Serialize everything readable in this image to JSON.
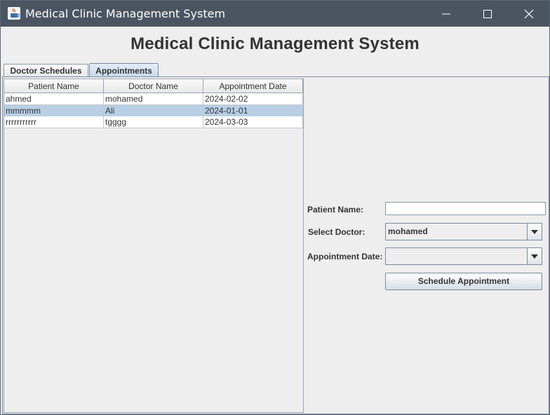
{
  "window": {
    "title": "Medical Clinic Management System",
    "controls": [
      "minimize-icon",
      "maximize-icon",
      "close-icon"
    ]
  },
  "header": {
    "title": "Medical Clinic Management System"
  },
  "tabs": [
    {
      "label": "Doctor Schedules",
      "selected": false
    },
    {
      "label": "Appointments",
      "selected": true
    }
  ],
  "appointments_table": {
    "columns": [
      "Patient Name",
      "Doctor Name",
      "Appointment Date"
    ],
    "rows": [
      {
        "patient": "ahmed",
        "doctor": "mohamed",
        "date": "2024-02-02",
        "selected": false
      },
      {
        "patient": "mmmmm",
        "doctor": "Ali",
        "date": "2024-01-01",
        "selected": true
      },
      {
        "patient": "rrrrrrrrrrr",
        "doctor": "tgggg",
        "date": "2024-03-03",
        "selected": false
      }
    ]
  },
  "form": {
    "patient_name_label": "Patient Name:",
    "patient_name_value": "",
    "doctor_label": "Select Doctor:",
    "doctor_selected": "mohamed",
    "date_label": "Appointment Date:",
    "date_selected": "",
    "schedule_button": "Schedule Appointment"
  },
  "colors": {
    "titlebar": "#4b5562",
    "background": "#eeeeee",
    "selected_row": "#b8cfe5",
    "selected_tab": "#c8d8ec"
  }
}
